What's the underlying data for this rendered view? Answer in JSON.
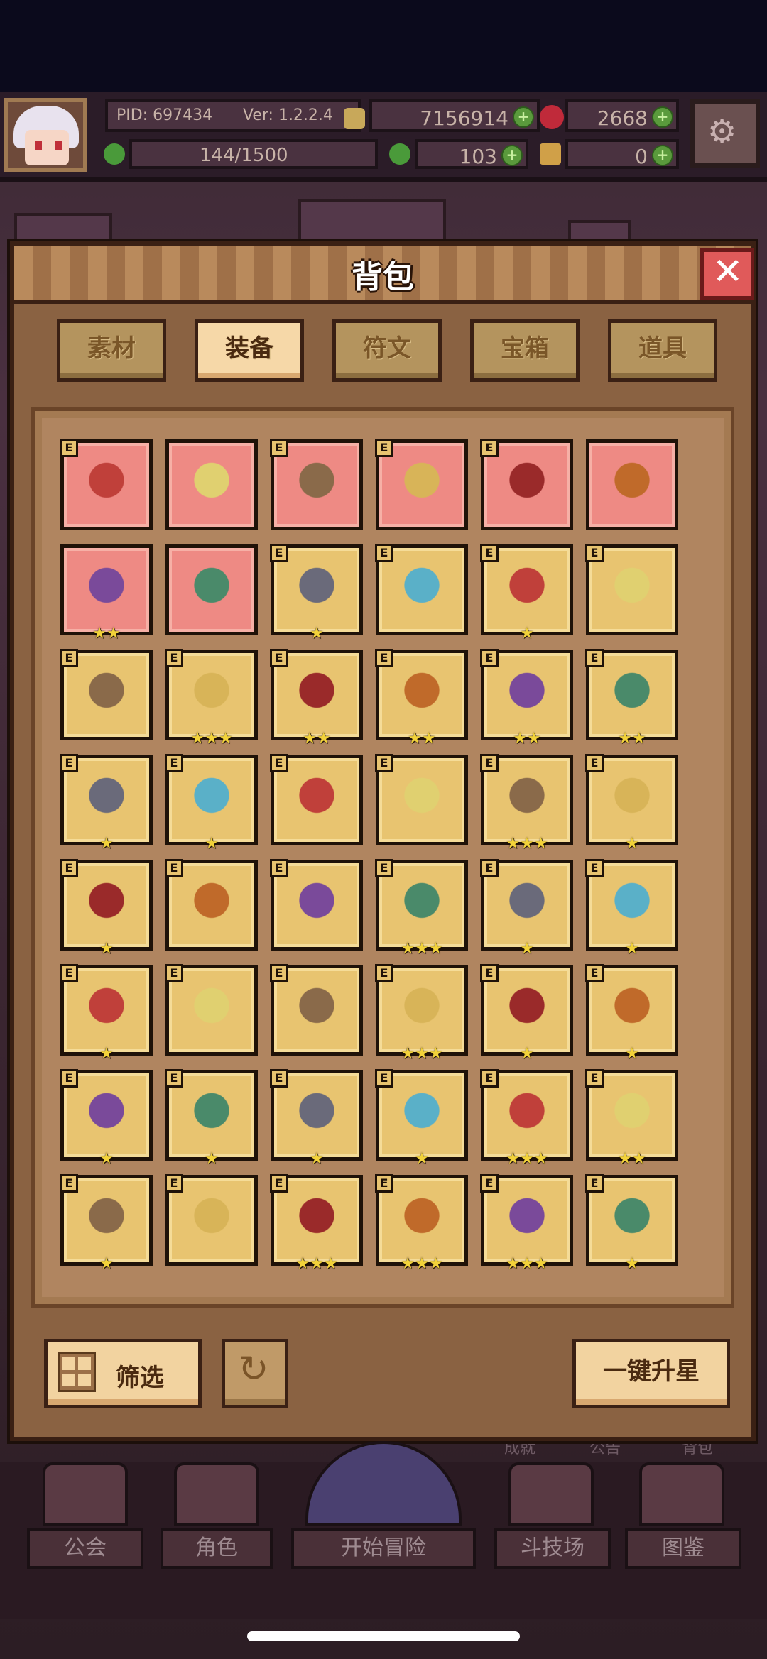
{
  "status_bar": {
    "pid": "PID: 697434",
    "version": "Ver: 1.2.2.4",
    "gold": "7156914",
    "gems": "2668",
    "exp": "144/1500",
    "clover": "103",
    "keys": "0"
  },
  "modal": {
    "title": "背包",
    "tabs": [
      {
        "label": "素材"
      },
      {
        "label": "装备"
      },
      {
        "label": "符文"
      },
      {
        "label": "宝箱"
      },
      {
        "label": "道具"
      }
    ],
    "active_tab": "装备",
    "slot_badge": "E",
    "items": [
      {
        "name": "crossed-swords-icon",
        "bg": "red",
        "stars": "",
        "badge": true
      },
      {
        "name": "straw-hat-icon",
        "bg": "red",
        "stars": "",
        "badge": false
      },
      {
        "name": "heart-amulet-icon",
        "bg": "red",
        "stars": "",
        "badge": true
      },
      {
        "name": "pink-necklace-icon",
        "bg": "red",
        "stars": "",
        "badge": true
      },
      {
        "name": "axe-icon",
        "bg": "red",
        "stars": "",
        "badge": true
      },
      {
        "name": "wooden-staff-icon",
        "bg": "red",
        "stars": "",
        "badge": false
      },
      {
        "name": "mushroom-cap-icon",
        "bg": "red",
        "stars": "★★",
        "badge": false
      },
      {
        "name": "ring-icon",
        "bg": "red",
        "stars": "",
        "badge": false
      },
      {
        "name": "bow-icon",
        "bg": "gold",
        "stars": "★",
        "badge": true
      },
      {
        "name": "mace-icon",
        "bg": "gold",
        "stars": "",
        "badge": true
      },
      {
        "name": "spear-icon",
        "bg": "gold",
        "stars": "★",
        "badge": true
      },
      {
        "name": "lantern-icon",
        "bg": "gold",
        "stars": "",
        "badge": true
      },
      {
        "name": "ice-shield-icon",
        "bg": "gold",
        "stars": "",
        "badge": true
      },
      {
        "name": "gold-circlet-icon",
        "bg": "gold",
        "stars": "★★★",
        "badge": true
      },
      {
        "name": "hood-icon",
        "bg": "gold",
        "stars": "★★",
        "badge": true
      },
      {
        "name": "winged-helm-icon",
        "bg": "gold",
        "stars": "★★",
        "badge": true
      },
      {
        "name": "dark-helm-icon",
        "bg": "gold",
        "stars": "★★",
        "badge": true
      },
      {
        "name": "golden-helm-icon",
        "bg": "gold",
        "stars": "★★",
        "badge": true
      },
      {
        "name": "leather-armor-icon",
        "bg": "gold",
        "stars": "★",
        "badge": true
      },
      {
        "name": "ice-armor-icon",
        "bg": "gold",
        "stars": "★",
        "badge": true
      },
      {
        "name": "gold-robe-icon",
        "bg": "gold",
        "stars": "",
        "badge": true
      },
      {
        "name": "dark-armor-icon",
        "bg": "gold",
        "stars": "",
        "badge": true
      },
      {
        "name": "gold-gauntlet-icon",
        "bg": "gold",
        "stars": "★★★",
        "badge": true
      },
      {
        "name": "ice-glove-icon",
        "bg": "gold",
        "stars": "★",
        "badge": true
      },
      {
        "name": "leather-glove-icon",
        "bg": "gold",
        "stars": "★",
        "badge": true
      },
      {
        "name": "bracer-icon",
        "bg": "gold",
        "stars": "",
        "badge": true
      },
      {
        "name": "fire-gauntlet-icon",
        "bg": "gold",
        "stars": "",
        "badge": true
      },
      {
        "name": "jeweled-crown-icon",
        "bg": "gold",
        "stars": "★★★",
        "badge": true
      },
      {
        "name": "gold-belt-icon",
        "bg": "gold",
        "stars": "★",
        "badge": true
      },
      {
        "name": "red-ring-icon",
        "bg": "gold",
        "stars": "★",
        "badge": true
      },
      {
        "name": "teal-belt-icon",
        "bg": "gold",
        "stars": "★",
        "badge": true
      },
      {
        "name": "lava-ring-icon",
        "bg": "gold",
        "stars": "",
        "badge": true
      },
      {
        "name": "horseshoe-necklace-icon",
        "bg": "gold",
        "stars": "",
        "badge": true
      },
      {
        "name": "gold-boots-icon",
        "bg": "gold",
        "stars": "★★★",
        "badge": true
      },
      {
        "name": "teal-boots-icon",
        "bg": "gold",
        "stars": "★",
        "badge": true
      },
      {
        "name": "copper-boots-icon",
        "bg": "gold",
        "stars": "★",
        "badge": true
      },
      {
        "name": "leather-boots-icon",
        "bg": "gold",
        "stars": "★",
        "badge": true
      },
      {
        "name": "ice-boots-icon",
        "bg": "gold",
        "stars": "★",
        "badge": true
      },
      {
        "name": "brown-boots-icon",
        "bg": "gold",
        "stars": "★",
        "badge": true
      },
      {
        "name": "purple-boots-icon",
        "bg": "gold",
        "stars": "★",
        "badge": true
      },
      {
        "name": "gold-emblem-icon",
        "bg": "gold",
        "stars": "★★★",
        "badge": true
      },
      {
        "name": "fire-gem-icon",
        "bg": "gold",
        "stars": "★★",
        "badge": true
      },
      {
        "name": "steel-orb-icon",
        "bg": "gold",
        "stars": "★",
        "badge": true
      },
      {
        "name": "fire-star-icon",
        "bg": "gold",
        "stars": "",
        "badge": true
      },
      {
        "name": "gold-necklace-icon",
        "bg": "gold",
        "stars": "★★★",
        "badge": true
      },
      {
        "name": "gold-ruby-ring-icon",
        "bg": "gold",
        "stars": "★★★",
        "badge": true
      },
      {
        "name": "ice-crystal-icon",
        "bg": "gold",
        "stars": "★★★",
        "badge": true
      },
      {
        "name": "flame-ring-icon",
        "bg": "gold",
        "stars": "★",
        "badge": true
      }
    ],
    "filter_label": "筛选",
    "star_up_label": "一键升星"
  },
  "bg_links": [
    "成就",
    "公告",
    "背包"
  ],
  "bottom_nav": [
    {
      "label": "公会"
    },
    {
      "label": "角色"
    },
    {
      "label": "开始冒险"
    },
    {
      "label": "斗技场"
    },
    {
      "label": "图鉴"
    }
  ],
  "colors": {
    "slot_red": "#ee8a84",
    "slot_gold": "#e8c470",
    "tab_active": "#f6d8a8",
    "close_red": "#e05a5a",
    "star": "#f2d23a"
  }
}
